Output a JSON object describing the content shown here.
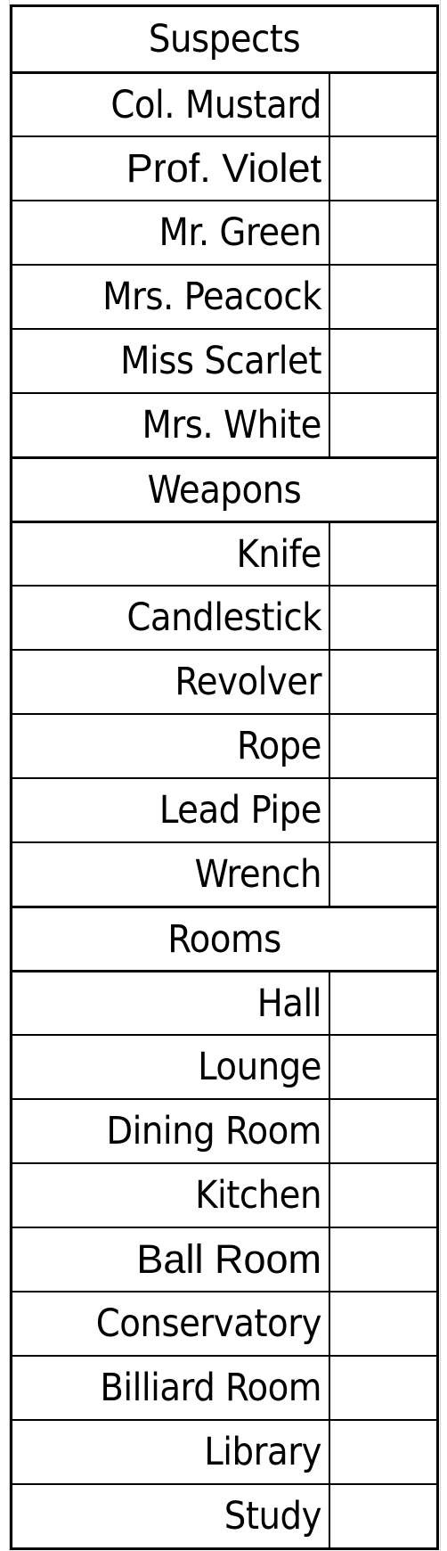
{
  "sections": [
    {
      "title": "Suspects",
      "items": [
        {
          "label": "Col. Mustard",
          "mark": ""
        },
        {
          "label": "Prof. Violet",
          "mark": ""
        },
        {
          "label": "Mr. Green",
          "mark": ""
        },
        {
          "label": "Mrs. Peacock",
          "mark": ""
        },
        {
          "label": "Miss Scarlet",
          "mark": ""
        },
        {
          "label": "Mrs. White",
          "mark": ""
        }
      ]
    },
    {
      "title": "Weapons",
      "items": [
        {
          "label": "Knife",
          "mark": ""
        },
        {
          "label": "Candlestick",
          "mark": ""
        },
        {
          "label": "Revolver",
          "mark": ""
        },
        {
          "label": "Rope",
          "mark": ""
        },
        {
          "label": "Lead Pipe",
          "mark": ""
        },
        {
          "label": "Wrench",
          "mark": ""
        }
      ]
    },
    {
      "title": "Rooms",
      "items": [
        {
          "label": "Hall",
          "mark": ""
        },
        {
          "label": "Lounge",
          "mark": ""
        },
        {
          "label": "Dining Room",
          "mark": ""
        },
        {
          "label": "Kitchen",
          "mark": ""
        },
        {
          "label": "Ball Room",
          "mark": ""
        },
        {
          "label": "Conservatory",
          "mark": ""
        },
        {
          "label": "Billiard Room",
          "mark": ""
        },
        {
          "label": "Library",
          "mark": ""
        },
        {
          "label": "Study",
          "mark": ""
        }
      ]
    }
  ]
}
